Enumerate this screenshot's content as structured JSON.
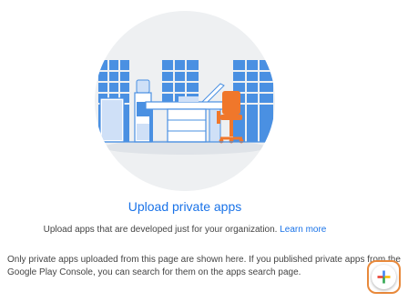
{
  "empty_state": {
    "title": "Upload private apps",
    "subtitle": "Upload apps that are developed just for your organization.",
    "learn_more": "Learn more"
  },
  "info": {
    "line1": "Only private apps uploaded from this page are shown here. If you published private apps from the",
    "line2": "Google Play Console, you can search for them on the apps search page."
  },
  "fab": {
    "icon": "plus-icon",
    "colors": {
      "blue": "#4285f4",
      "red": "#ea4335",
      "yellow": "#fbbc04",
      "green": "#34a853",
      "highlight": "#e8893b"
    }
  },
  "theme": {
    "link": "#1a73e8",
    "illustration_blue": "#4a90e2",
    "chair_orange": "#f0772b"
  }
}
